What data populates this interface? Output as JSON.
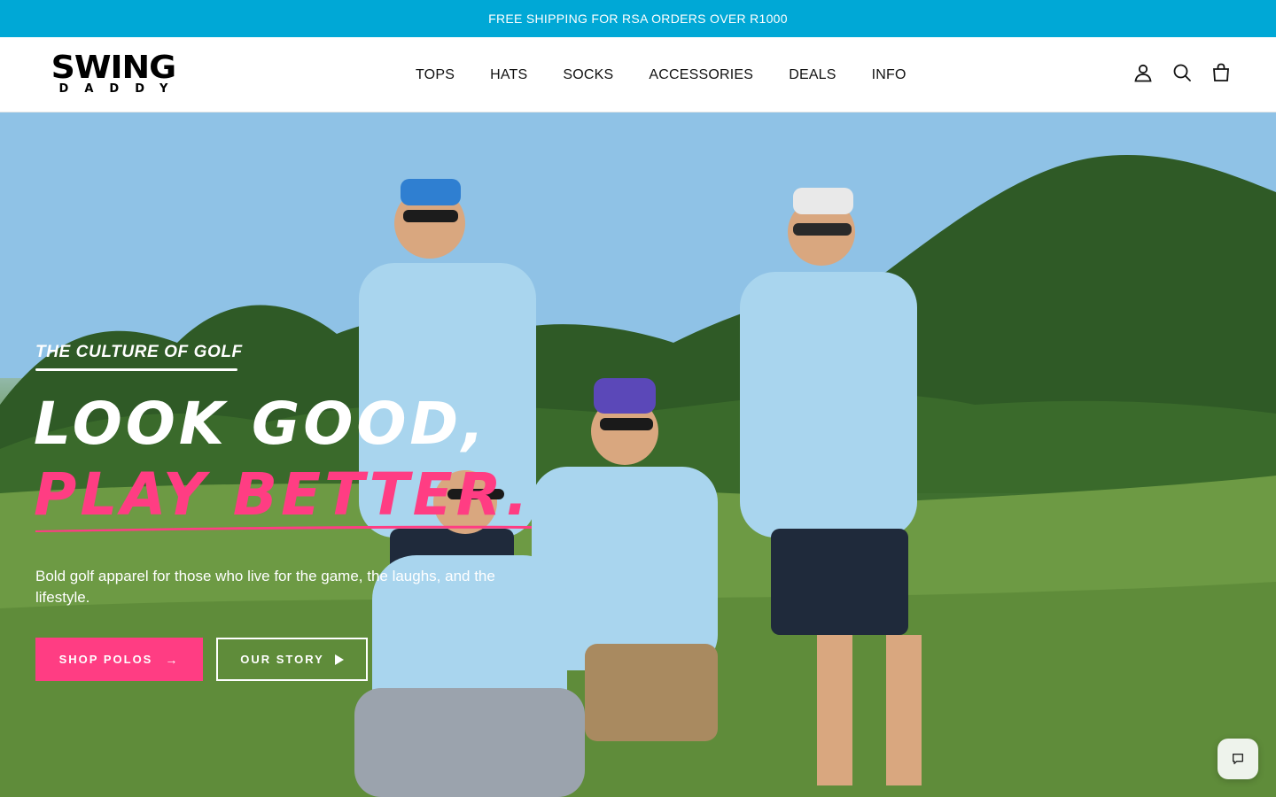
{
  "announcement": {
    "text": "FREE SHIPPING FOR RSA ORDERS OVER R1000"
  },
  "brand": {
    "logo_top": "SWING",
    "logo_bottom": "DADDY"
  },
  "nav": {
    "items": [
      {
        "label": "TOPS"
      },
      {
        "label": "HATS"
      },
      {
        "label": "SOCKS"
      },
      {
        "label": "ACCESSORIES"
      },
      {
        "label": "DEALS"
      },
      {
        "label": "INFO"
      }
    ]
  },
  "header_icons": [
    "account-icon",
    "search-icon",
    "cart-icon"
  ],
  "hero": {
    "eyebrow": "THE CULTURE OF GOLF",
    "headline_line1": "LOOK GOOD,",
    "headline_line2": "PLAY BETTER.",
    "subtext": "Bold golf apparel for those who live for the game, the laughs, and the lifestyle.",
    "primary_button": {
      "label": "SHOP POLOS",
      "icon": "arrow-right-icon"
    },
    "secondary_button": {
      "label": "OUR STORY",
      "icon": "play-icon"
    }
  },
  "chat": {
    "icon": "chat-icon"
  },
  "colors": {
    "announcement_bg": "#00a8d6",
    "accent_pink": "#ff3d83",
    "text_dark": "#111111"
  }
}
